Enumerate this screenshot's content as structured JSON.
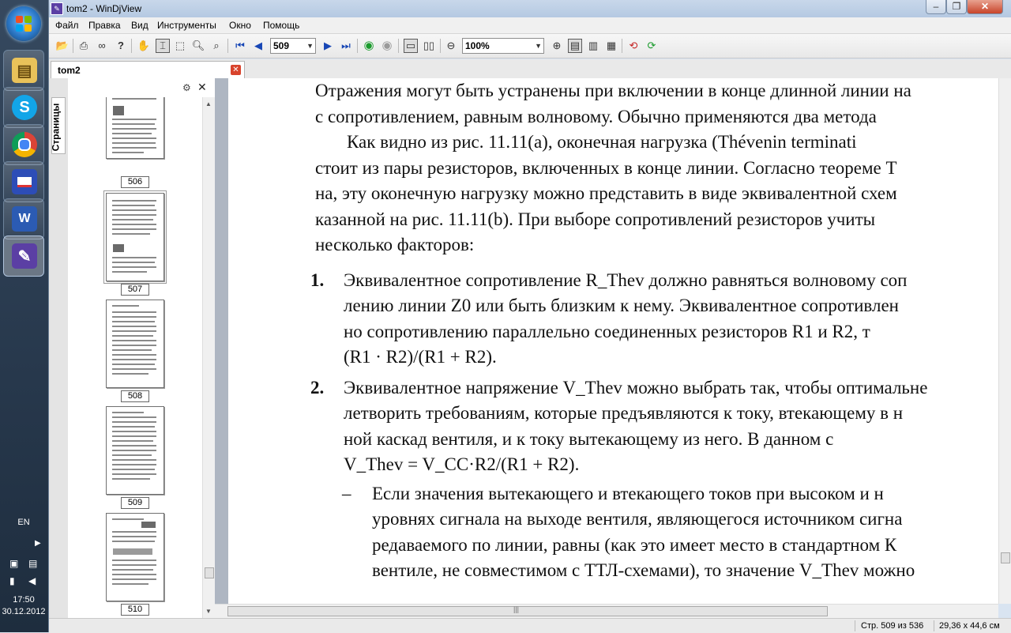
{
  "window": {
    "title": "tom2 - WinDjView",
    "app_icon": "windjview-icon"
  },
  "menu": [
    "Файл",
    "Правка",
    "Вид",
    "Инструменты",
    "Окно",
    "Помощь"
  ],
  "toolbar": {
    "page_value": "509",
    "zoom_value": "100%"
  },
  "tab": {
    "label": "tom2"
  },
  "sidebar": {
    "tab_label": "Страницы",
    "pages": [
      "506",
      "507",
      "508",
      "509",
      "510"
    ],
    "current_page": "509"
  },
  "document": {
    "lines": [
      "Отражения могут быть устранены при включении в конце длинной линии на",
      "с сопротивлением, равным волновому. Обычно применяются два метода",
      "Как видно из рис. 11.11(a), оконечная нагрузка (Thévenin terminati",
      "стоит из пары резисторов, включенных в конце линии. Согласно теореме Т",
      "на, эту оконечную нагрузку можно представить в виде эквивалентной схем",
      "казанной на рис. 11.11(b). При выборе сопротивлений резисторов учиты",
      "несколько факторов:",
      "Эквивалентное сопротивление R_Thev должно равняться волновому соп",
      "лению линии Z0 или быть близким к нему. Эквивалентное сопротивлен",
      "но сопротивлению параллельно соединенных резисторов R1 и R2, т",
      "(R1 · R2)/(R1 + R2).",
      "Эквивалентное напряжение V_Thev можно выбрать так, чтобы оптимальне",
      "летворить требованиям, которые предъявляются к току, втекающему в н",
      "ной каскад вентиля, и к току вытекающему из него. В данном с",
      "V_Thev = V_CC·R2/(R1 + R2).",
      "Если значения вытекающего и втекающего токов при высоком и н",
      "уровнях сигнала на выходе вентиля, являющегося источником сигна",
      "редаваемого по линии, равны (как это имеет место в стандартном К",
      "вентиле, не совместимом с ТТЛ-схемами), то значение V_Thev можно"
    ],
    "list_numbers": [
      "1.",
      "2."
    ],
    "dash": "–"
  },
  "status": {
    "page_info": "Стр. 509 из 536",
    "page_size": "29,36 x 44,6 см"
  },
  "taskbar": {
    "language": "EN",
    "time": "17:50",
    "date": "30.12.2012",
    "apps": [
      "file-explorer-icon",
      "skype-icon",
      "chrome-icon",
      "floppy-save-icon",
      "word-icon",
      "windjview-icon"
    ]
  },
  "colors": {
    "taskbar": "#2b3e53",
    "close_button": "#c8442a",
    "viewer_bg": "#aeb6c2"
  }
}
